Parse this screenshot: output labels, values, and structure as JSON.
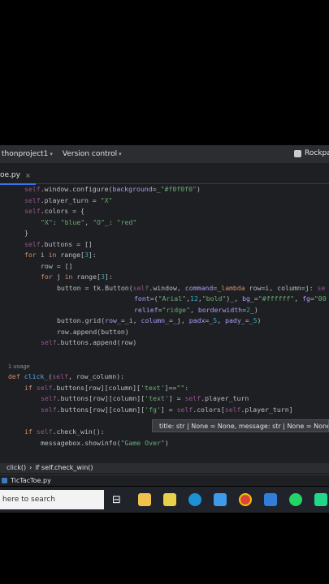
{
  "menubar": {
    "project": "thonproject1",
    "vcs": "Version control",
    "right_label": "Rockpa"
  },
  "tab": {
    "label": "oe.py",
    "close": "×"
  },
  "code": {
    "l1a": "self",
    "l1b": ".window.configure(",
    "l1c": "background",
    "l1d": "=_",
    "l1e": "\"#f0f0f0\"",
    "l1f": ")",
    "l2a": "self",
    "l2b": ".player_turn = ",
    "l2c": "\"X\"",
    "l3a": "self",
    "l3b": ".colors = {",
    "l4a": "\"X\"",
    "l4b": ": ",
    "l4c": "\"blue\"",
    "l4d": ", ",
    "l4e": "\"O\"",
    "l4f": "_: ",
    "l4g": "\"red\"",
    "l5": "}",
    "l6a": "self",
    "l6b": ".buttons = []",
    "l7a": "for",
    "l7b": " i ",
    "l7c": "in",
    "l7d": " range",
    "l7e": "[",
    "l7f": "3",
    "l7g": "]:",
    "l8": "row = []",
    "l9a": "for",
    "l9b": " j ",
    "l9c": "in",
    "l9d": " range",
    "l9e": "[",
    "l9f": "3",
    "l9g": "]:",
    "l10a": "button = tk.Button(",
    "l10b": "self",
    "l10c": ".window, ",
    "l10d": "command",
    "l10e": "=_",
    "l10f": "lambda",
    "l10g": " row",
    "l10h": "=i, ",
    "l10i": "column",
    "l10j": "=j: ",
    "l10k": "se",
    "l11a": "font",
    "l11b": "=(",
    "l11c": "\"Arial\"",
    "l11d": ",",
    "l11e": "12",
    "l11f": ",",
    "l11g": "\"bold\"",
    "l11h": ")_, ",
    "l11i": "bg",
    "l11j": "_=",
    "l11k": "\"#ffffff\"",
    "l11l": ", ",
    "l11m": "fg",
    "l11n": "=",
    "l11o": "\"00",
    "l12a": "relief",
    "l12b": "=",
    "l12c": "\"ridge\"",
    "l12d": ", ",
    "l12e": "borderwidth",
    "l12f": "=",
    "l12g": "2",
    "l12h": "_)",
    "l13a": "button.grid(",
    "l13b": "row",
    "l13c": "_=_i, ",
    "l13d": "column",
    "l13e": "_=_j, ",
    "l13f": "padx",
    "l13g": "=_",
    "l13h": "5",
    "l13i": ", ",
    "l13j": "pady",
    "l13k": "_=_",
    "l13l": "5",
    "l13m": ")",
    "l14": "row.append(button)",
    "l15a": "self",
    "l15b": ".buttons.append(row)",
    "usage": "1 usage",
    "l16a": "def",
    "l16b": " click_",
    "l16c": "(",
    "l16d": "self",
    "l16e": ", row",
    "l16f": "_",
    "l16g": "column):",
    "l17a": "if",
    "l17b": " ",
    "l17c": "self",
    "l17d": ".buttons[row][column][",
    "l17e": "'text'",
    "l17f": "]==",
    "l17g": "\"\"",
    "l17h": ":",
    "l18a": "self",
    "l18b": ".buttons[row][column][",
    "l18c": "'text'",
    "l18d": "] = ",
    "l18e": "self",
    "l18f": ".player_turn",
    "l19a": "self",
    "l19b": ".buttons[row][column][",
    "l19c": "'fg'",
    "l19d": "] = ",
    "l19e": "self",
    "l19f": ".colors[",
    "l19g": "self",
    "l19h": ".player_turn]",
    "l20a": "if",
    "l20b": " ",
    "l20c": "self",
    "l20d": ".check_win():",
    "l21a": "messagebox.showinfo(",
    "l21b": "\"Game Over\"",
    "l21c": ")"
  },
  "hint": {
    "text": "title: str | None = None, message: str | None = None,"
  },
  "breadcrumbs": {
    "item1": "click()",
    "sep": "›",
    "item2": "if self.check_win()"
  },
  "filebar": {
    "label": "TicTacToe.py"
  },
  "taskbar": {
    "search_placeholder": "here to search",
    "task_view": "⊟"
  },
  "colors": {
    "accent": "#3574f0",
    "editor_bg": "#1e1f22"
  }
}
